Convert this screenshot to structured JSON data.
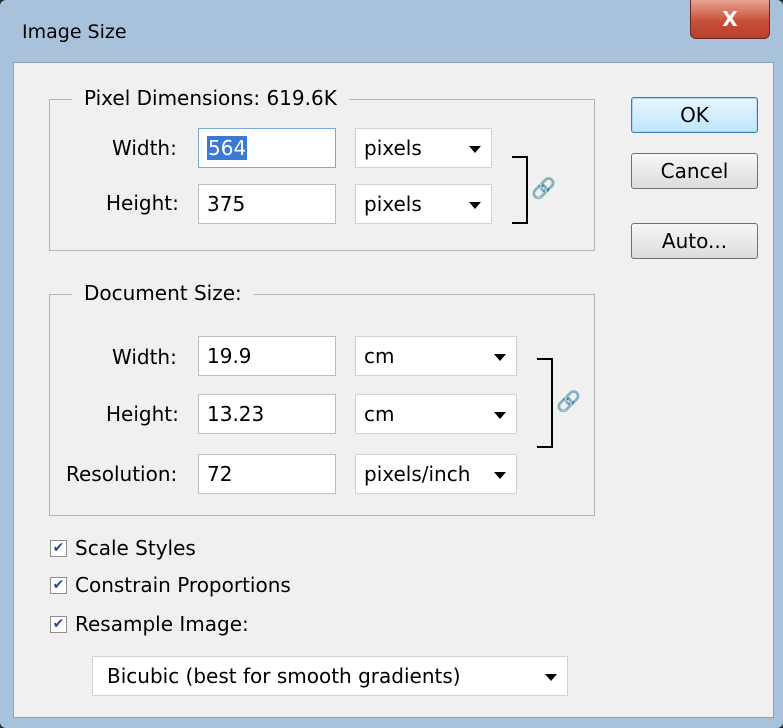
{
  "window": {
    "title": "Image Size",
    "close_label": "X"
  },
  "buttons": {
    "ok": "OK",
    "cancel": "Cancel",
    "auto": "Auto..."
  },
  "pixel_dimensions": {
    "legend": "Pixel Dimensions:  619.6K",
    "width_label": "Width:",
    "width_value": "564",
    "width_unit": "pixels",
    "height_label": "Height:",
    "height_value": "375",
    "height_unit": "pixels"
  },
  "document_size": {
    "legend": "Document Size:",
    "width_label": "Width:",
    "width_value": "19.9",
    "width_unit": "cm",
    "height_label": "Height:",
    "height_value": "13.23",
    "height_unit": "cm",
    "resolution_label": "Resolution:",
    "resolution_value": "72",
    "resolution_unit": "pixels/inch"
  },
  "options": {
    "scale_styles": {
      "label": "Scale Styles",
      "checked": true
    },
    "constrain_proportions": {
      "label": "Constrain Proportions",
      "checked": true
    },
    "resample_image": {
      "label": "Resample Image:",
      "checked": true
    },
    "resample_method": "Bicubic (best for smooth gradients)"
  },
  "icons": {
    "link": "chain-link-icon",
    "dropdown": "chevron-down-icon",
    "check": "checkmark-icon"
  },
  "colors": {
    "selection": "#3a79d6",
    "close_button": "#c9513a",
    "frame": "#a9c2dc",
    "dialog_bg": "#f0f0f0"
  }
}
